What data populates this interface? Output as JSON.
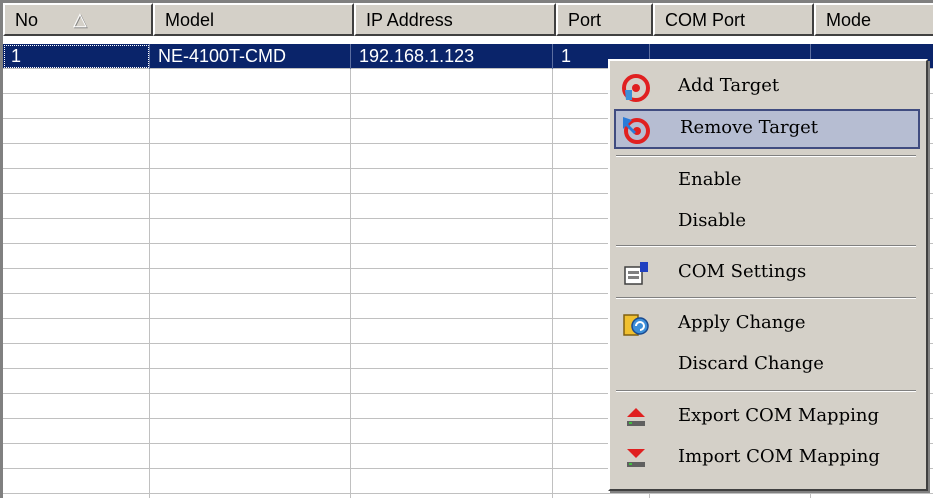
{
  "table": {
    "columns": [
      "No",
      "Model",
      "IP Address",
      "Port",
      "COM Port",
      "Mode"
    ],
    "selected_row": {
      "no": "1",
      "model": "NE-4100T-CMD",
      "ip": "192.168.1.123",
      "port": "1"
    }
  },
  "menu": {
    "items": [
      {
        "label": "Add Target",
        "icon": "add-target-icon"
      },
      {
        "label": "Remove Target",
        "icon": "remove-target-icon",
        "highlighted": true
      },
      {
        "label": "Enable"
      },
      {
        "label": "Disable"
      },
      {
        "label": "COM Settings",
        "icon": "com-settings-icon"
      },
      {
        "label": "Apply Change",
        "icon": "apply-change-icon"
      },
      {
        "label": "Discard Change"
      },
      {
        "label": "Export COM Mapping",
        "icon": "export-icon"
      },
      {
        "label": "Import COM Mapping",
        "icon": "import-icon"
      }
    ]
  },
  "colors": {
    "selection": "#0a246a",
    "menu_highlight": "#b6bdd2",
    "chrome": "#d4d0c8"
  }
}
